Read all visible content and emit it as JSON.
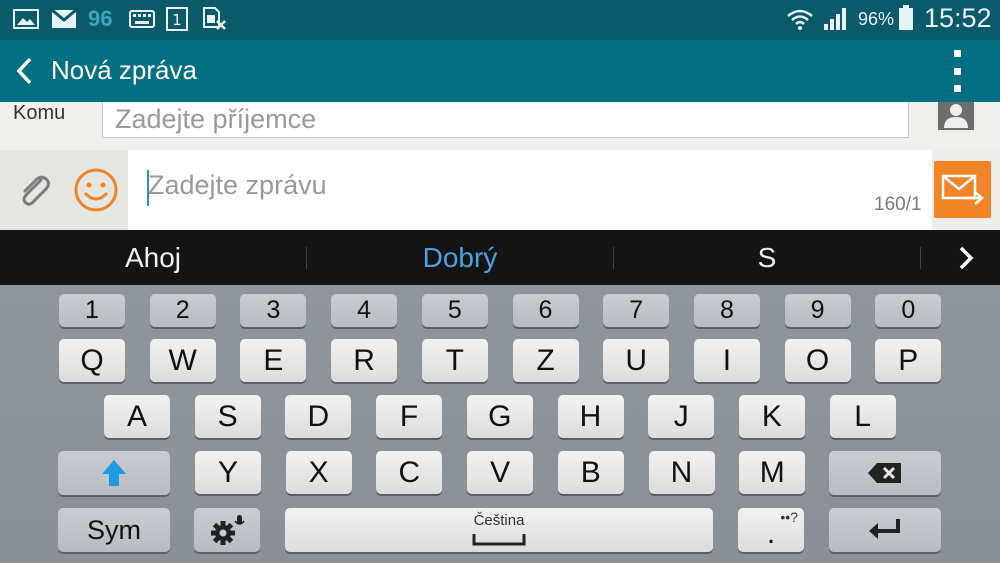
{
  "status_bar": {
    "notification_count": "96",
    "battery_percent": "96%",
    "time": "15:52",
    "icons": [
      "image-icon",
      "gmail-icon",
      "keyboard-icon",
      "sim-1-icon",
      "no-sim-icon",
      "wifi-icon",
      "signal-icon",
      "battery-icon"
    ]
  },
  "app_bar": {
    "title": "Nová zpráva"
  },
  "recipient": {
    "label": "Komu",
    "placeholder": "Zadejte příjemce"
  },
  "compose": {
    "placeholder": "Zadejte zprávu",
    "counter": "160/1"
  },
  "suggestions": {
    "items": [
      "Ahoj",
      "Dobrý",
      "S"
    ],
    "active_index": 1
  },
  "keyboard": {
    "row_numbers": [
      "1",
      "2",
      "3",
      "4",
      "5",
      "6",
      "7",
      "8",
      "9",
      "0"
    ],
    "row1": [
      "Q",
      "W",
      "E",
      "R",
      "T",
      "Z",
      "U",
      "I",
      "O",
      "P"
    ],
    "row2": [
      "A",
      "S",
      "D",
      "F",
      "G",
      "H",
      "J",
      "K",
      "L"
    ],
    "row3": [
      "Y",
      "X",
      "C",
      "V",
      "B",
      "N",
      "M"
    ],
    "sym_label": "Sym",
    "space_label": "Čeština",
    "period_label": ".",
    "period_hint": "••?"
  },
  "colors": {
    "status_bar": "#0a5a6a",
    "app_bar": "#036f82",
    "send_button": "#f18526",
    "emoji": "#f18526",
    "suggestion_active": "#4aa3e0",
    "shift_arrow": "#1e9ae0"
  }
}
